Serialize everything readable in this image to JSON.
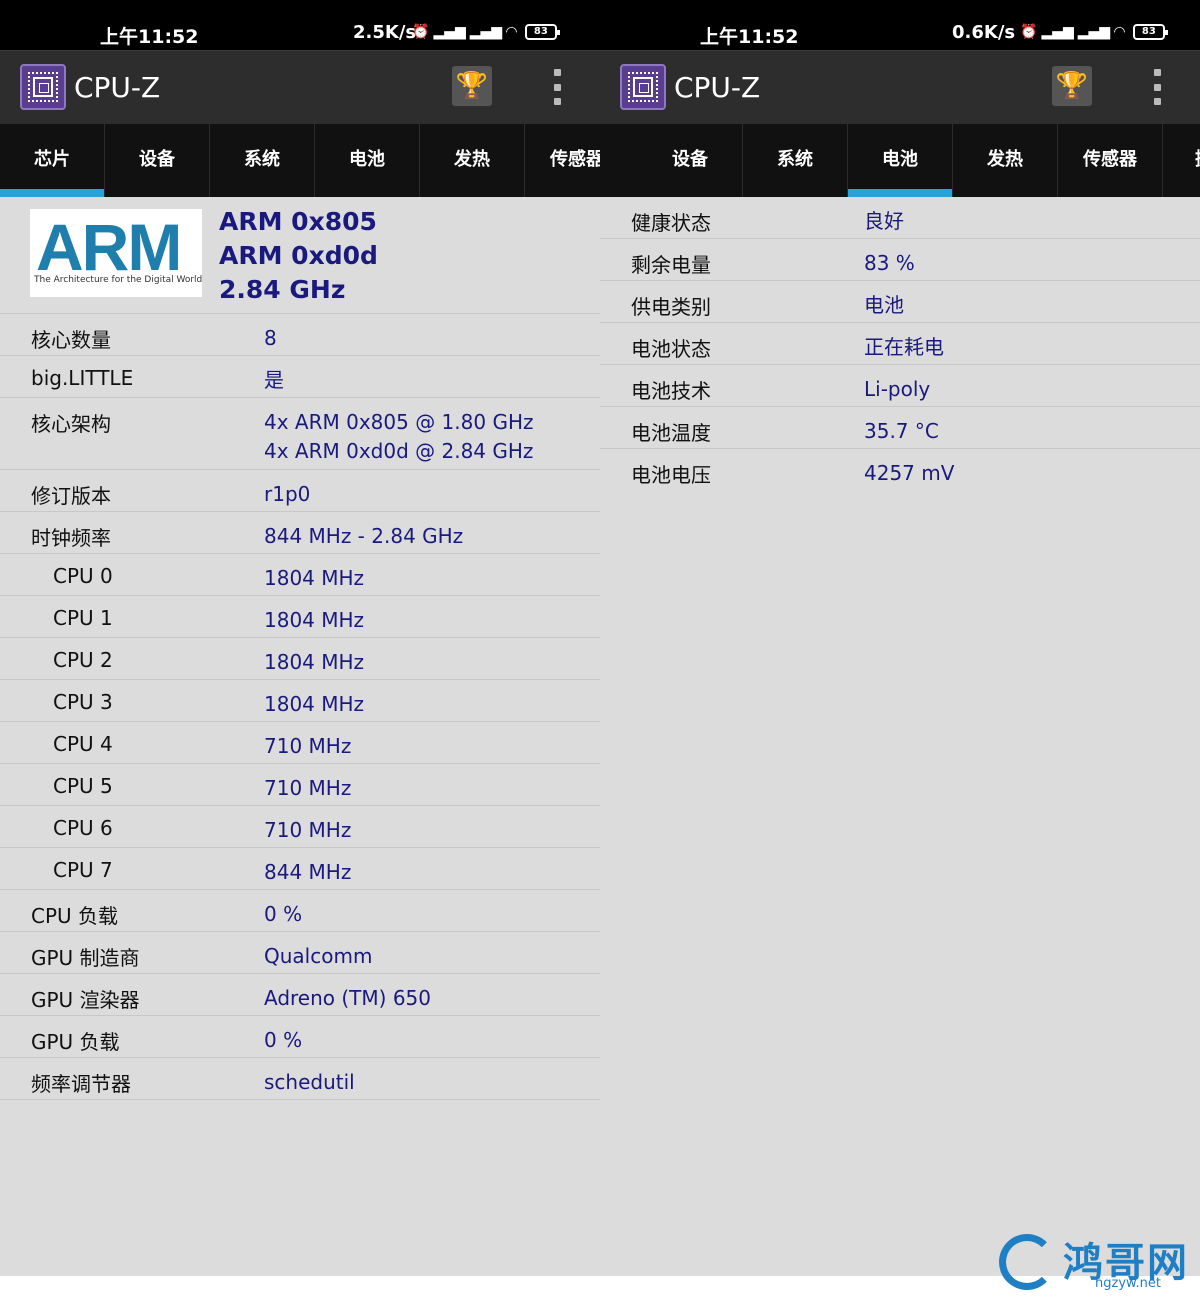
{
  "left_screen": {
    "status": {
      "time": "上午11:52",
      "rate": "2.5K/s",
      "battery": "83"
    },
    "app_title": "CPU-Z",
    "tabs": [
      "芯片",
      "设备",
      "系统",
      "电池",
      "发热",
      "传感器"
    ],
    "active_tab": "芯片",
    "soc": {
      "logo_text": "ARM",
      "logo_tagline": "The Architecture for the Digital World",
      "lines": [
        "ARM 0x805",
        "ARM 0xd0d",
        "2.84 GHz"
      ]
    },
    "rows": [
      {
        "label": "核心数量",
        "value": "8"
      },
      {
        "label": "big.LITTLE",
        "value": "是"
      },
      {
        "label": "核心架构",
        "value": "4x ARM 0x805 @ 1.80 GHz",
        "value2": "4x ARM 0xd0d @ 2.84 GHz"
      },
      {
        "label": "修订版本",
        "value": "r1p0"
      },
      {
        "label": "时钟频率",
        "value": "844 MHz - 2.84 GHz"
      },
      {
        "label": "CPU 0",
        "value": "1804 MHz"
      },
      {
        "label": "CPU 1",
        "value": "1804 MHz"
      },
      {
        "label": "CPU 2",
        "value": "1804 MHz"
      },
      {
        "label": "CPU 3",
        "value": "1804 MHz"
      },
      {
        "label": "CPU 4",
        "value": "710 MHz"
      },
      {
        "label": "CPU 5",
        "value": "710 MHz"
      },
      {
        "label": "CPU 6",
        "value": "710 MHz"
      },
      {
        "label": "CPU 7",
        "value": "844 MHz"
      },
      {
        "label": "CPU 负载",
        "value": "0 %"
      },
      {
        "label": "GPU 制造商",
        "value": "Qualcomm"
      },
      {
        "label": "GPU 渲染器",
        "value": "Adreno (TM) 650"
      },
      {
        "label": "GPU 负载",
        "value": "0 %"
      },
      {
        "label": "频率调节器",
        "value": "schedutil"
      }
    ]
  },
  "right_screen": {
    "status": {
      "time": "上午11:52",
      "rate": "0.6K/s",
      "battery": "83"
    },
    "app_title": "CPU-Z",
    "tabs": [
      "设备",
      "系统",
      "电池",
      "发热",
      "传感器",
      "摄"
    ],
    "active_tab": "电池",
    "rows": [
      {
        "label": "健康状态",
        "value": "良好"
      },
      {
        "label": "剩余电量",
        "value": "83 %"
      },
      {
        "label": "供电类别",
        "value": "电池"
      },
      {
        "label": "电池状态",
        "value": "正在耗电"
      },
      {
        "label": "电池技术",
        "value": "Li-poly"
      },
      {
        "label": "电池温度",
        "value": "35.7 °C"
      },
      {
        "label": "电池电压",
        "value": "4257 mV"
      }
    ]
  },
  "watermark": {
    "name": "鸿哥网",
    "url": "hgzyw.net"
  },
  "colors": {
    "accent": "#2aa1d8",
    "value_text": "#1a1a7e",
    "background": "#dcdcdc",
    "appbar": "#2d2d2d",
    "tabbar": "#111111"
  }
}
